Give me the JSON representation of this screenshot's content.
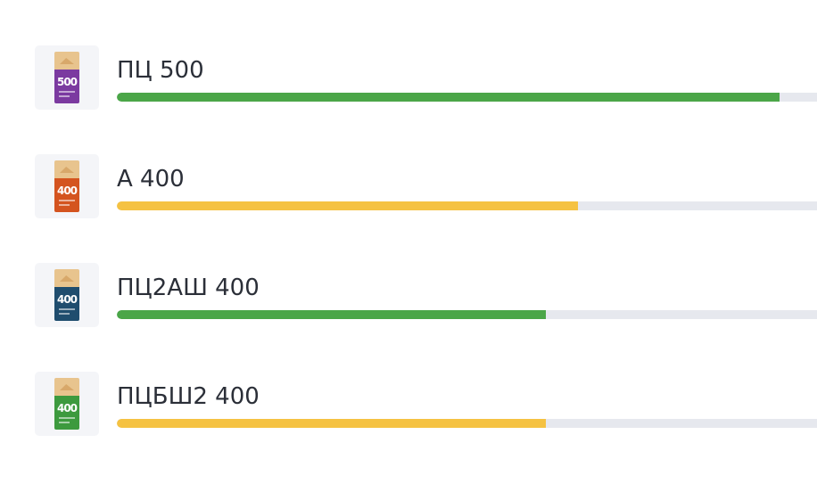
{
  "colors": {
    "green": "#4ba648",
    "yellow": "#f5c242",
    "track": "#e6e8ee"
  },
  "items": [
    {
      "name": "ПЦ 500",
      "bag_label": "500",
      "bag_color": "#7b3aa0",
      "bag_icon": "cement-bag-icon",
      "progress": 0.947,
      "bar_color": "#4ba648"
    },
    {
      "name": "А 400",
      "bag_label": "400",
      "bag_color": "#d4541f",
      "bag_icon": "cement-bag-icon",
      "progress": 0.658,
      "bar_color": "#f5c242"
    },
    {
      "name": "ПЦ2АШ 400",
      "bag_label": "400",
      "bag_color": "#1f4d6e",
      "bag_icon": "cement-bag-icon",
      "progress": 0.613,
      "bar_color": "#4ba648"
    },
    {
      "name": "ПЦБШ2 400",
      "bag_label": "400",
      "bag_color": "#3d9a3e",
      "bag_icon": "cement-bag-icon",
      "progress": 0.613,
      "bar_color": "#f5c242"
    }
  ]
}
